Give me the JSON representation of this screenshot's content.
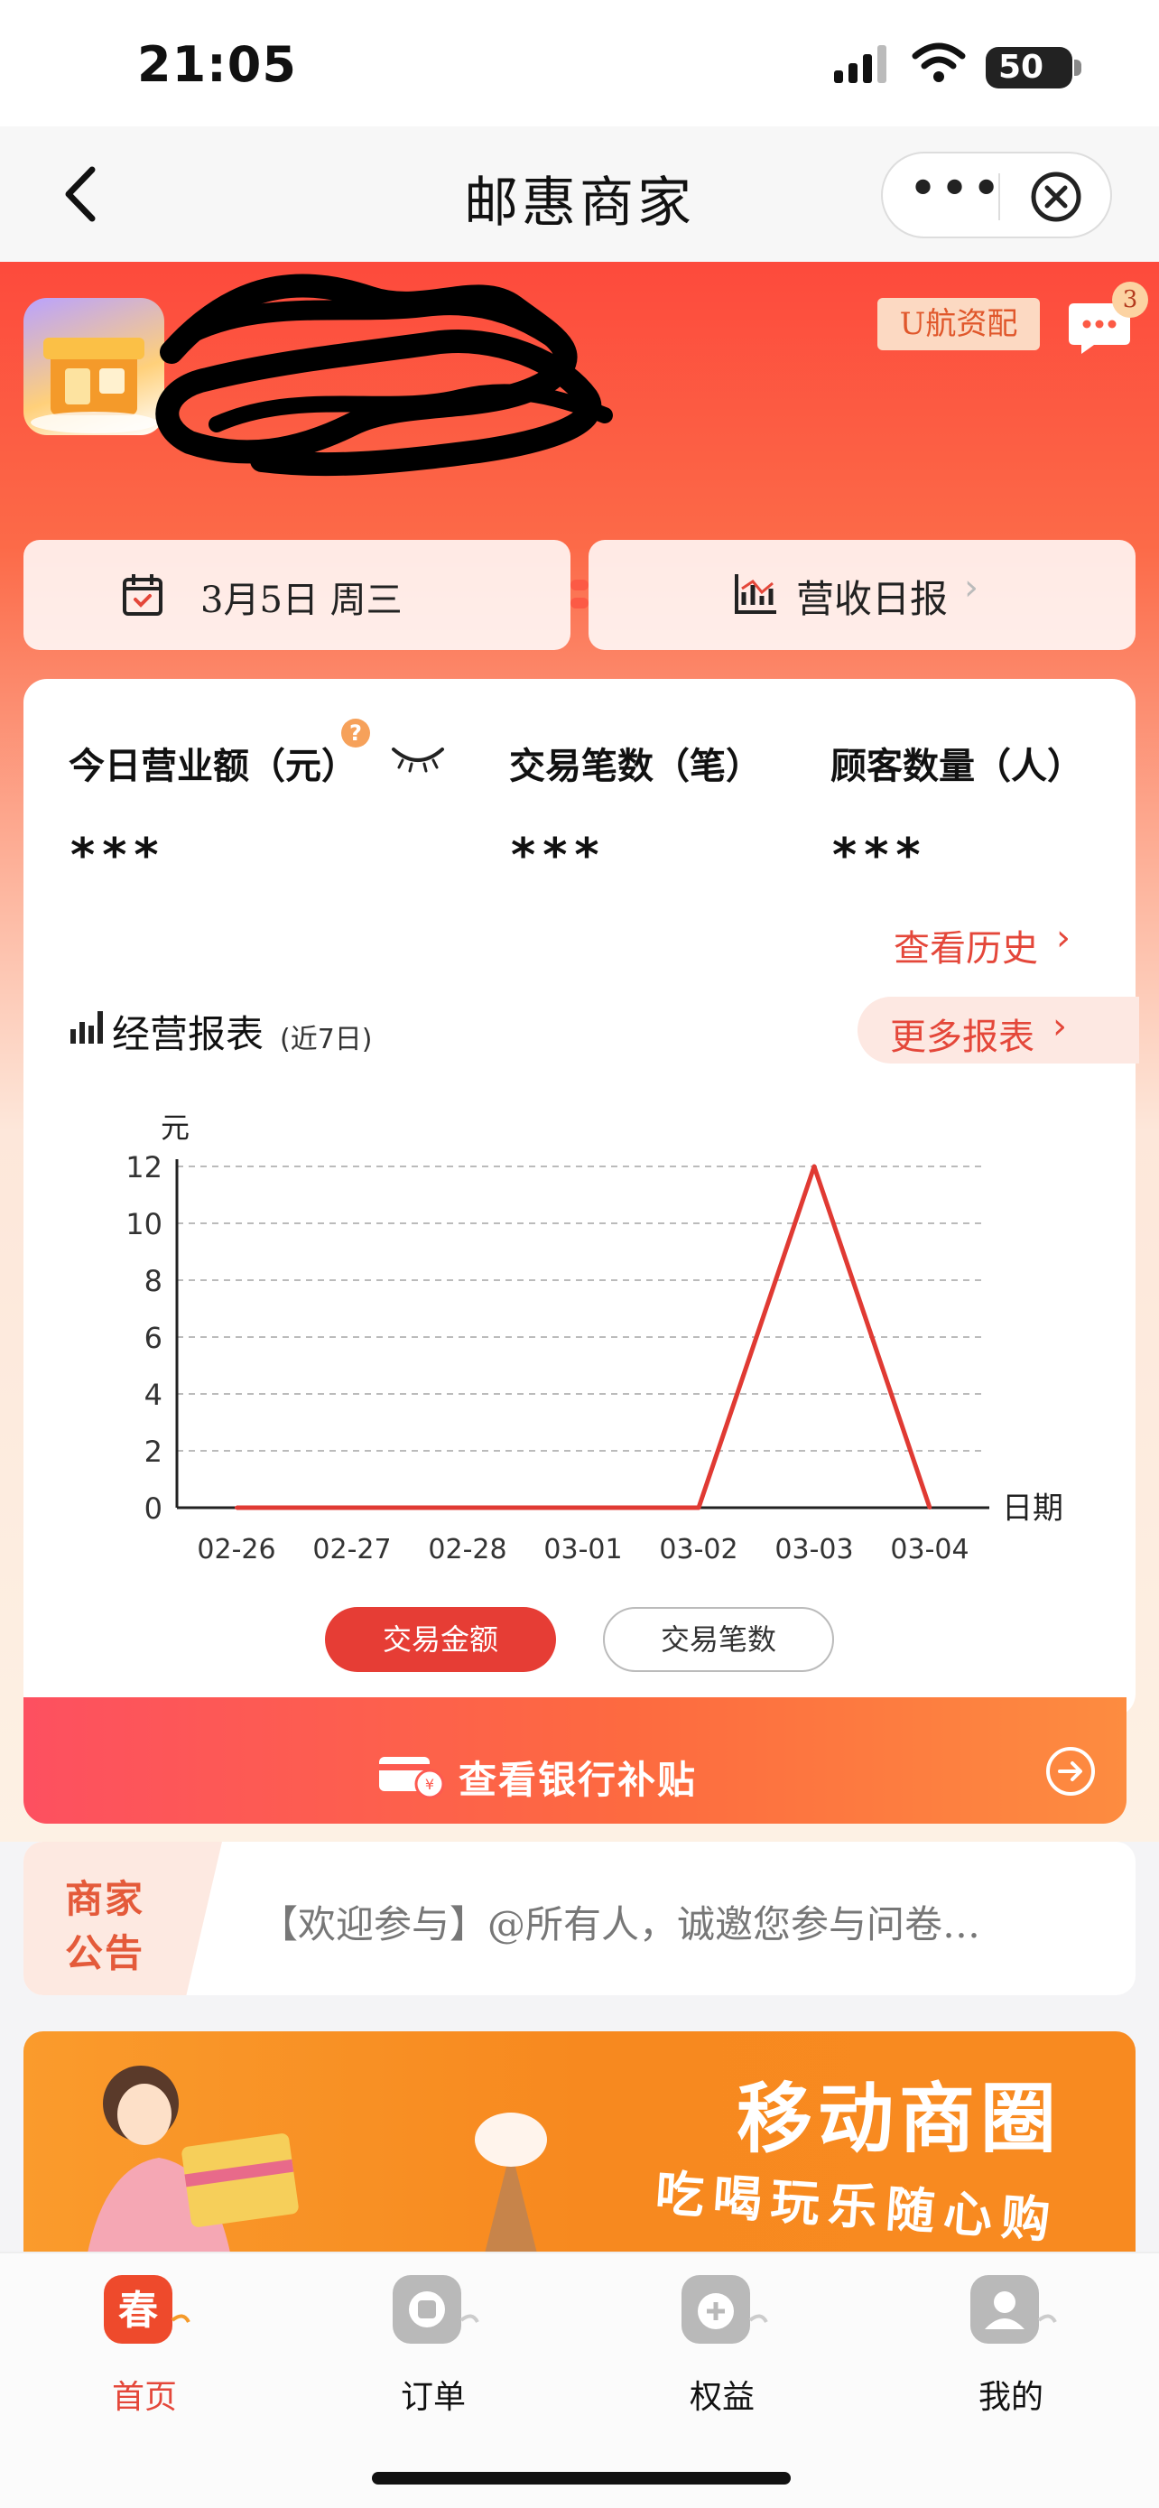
{
  "status": {
    "time": "21:05",
    "battery": "50"
  },
  "nav": {
    "title": "邮惠商家"
  },
  "header": {
    "tag": "U航资配",
    "message_count": "3"
  },
  "quick": {
    "date_label": "3月5日 周三",
    "report_label": "营收日报",
    "report_arrow": "›"
  },
  "stats": [
    {
      "label": "今日营业额（元）",
      "value": "***"
    },
    {
      "label": "交易笔数（笔）",
      "value": "***"
    },
    {
      "label": "顾客数量（人）",
      "value": "***"
    }
  ],
  "help_mark": "?",
  "history": {
    "label": "查看历史",
    "arrow": "›"
  },
  "section": {
    "title": "经营报表",
    "subtitle": "(近7日)",
    "more": "更多报表",
    "more_arrow": "›"
  },
  "chart_data": {
    "type": "line",
    "title": "",
    "xlabel": "日期",
    "ylabel": "元",
    "categories": [
      "02-26",
      "02-27",
      "02-28",
      "03-01",
      "03-02",
      "03-03",
      "03-04"
    ],
    "series": [
      {
        "values": [
          0,
          0,
          0,
          0,
          0,
          12,
          0
        ]
      }
    ],
    "ylim": [
      0,
      12
    ],
    "yticks": [
      0,
      2,
      4,
      6,
      8,
      10,
      12
    ],
    "grid": true,
    "color": "#e03a33"
  },
  "legend": {
    "active": "交易金额",
    "inactive": "交易笔数"
  },
  "bank": {
    "label": "查看银行补贴"
  },
  "notice": {
    "badge_line1": "商家",
    "badge_line2": "公告",
    "text": "【欢迎参与】@所有人，诚邀您参与问卷…"
  },
  "banner": {
    "title": "移动商圈",
    "subtitle": "吃喝玩乐随心购"
  },
  "tabs": [
    {
      "label": "首页",
      "active": true
    },
    {
      "label": "订单",
      "active": false
    },
    {
      "label": "权益",
      "active": false
    },
    {
      "label": "我的",
      "active": false
    }
  ]
}
